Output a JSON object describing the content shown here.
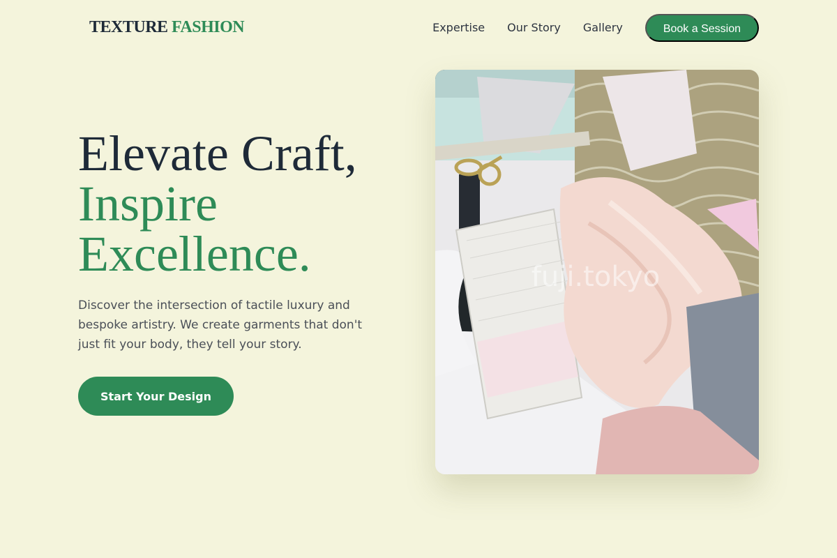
{
  "brand": {
    "part1": "TEXTURE",
    "part2": "FASHION"
  },
  "nav": {
    "items": [
      "Expertise",
      "Our Story",
      "Gallery"
    ],
    "cta_label": "Book a Session"
  },
  "hero": {
    "title_line1": "Elevate Craft,",
    "title_line2": "Inspire",
    "title_line3": "Excellence.",
    "description": "Discover the intersection of tactile luxury and bespoke artistry. We create garments that don't just fit your body, they tell your story.",
    "cta_label": "Start Your Design",
    "image_watermark": "fuji.tokyo"
  },
  "colors": {
    "background": "#f4f4dc",
    "accent": "#2e8b57",
    "heading": "#1e2a38",
    "body_text": "#4a4f57"
  }
}
